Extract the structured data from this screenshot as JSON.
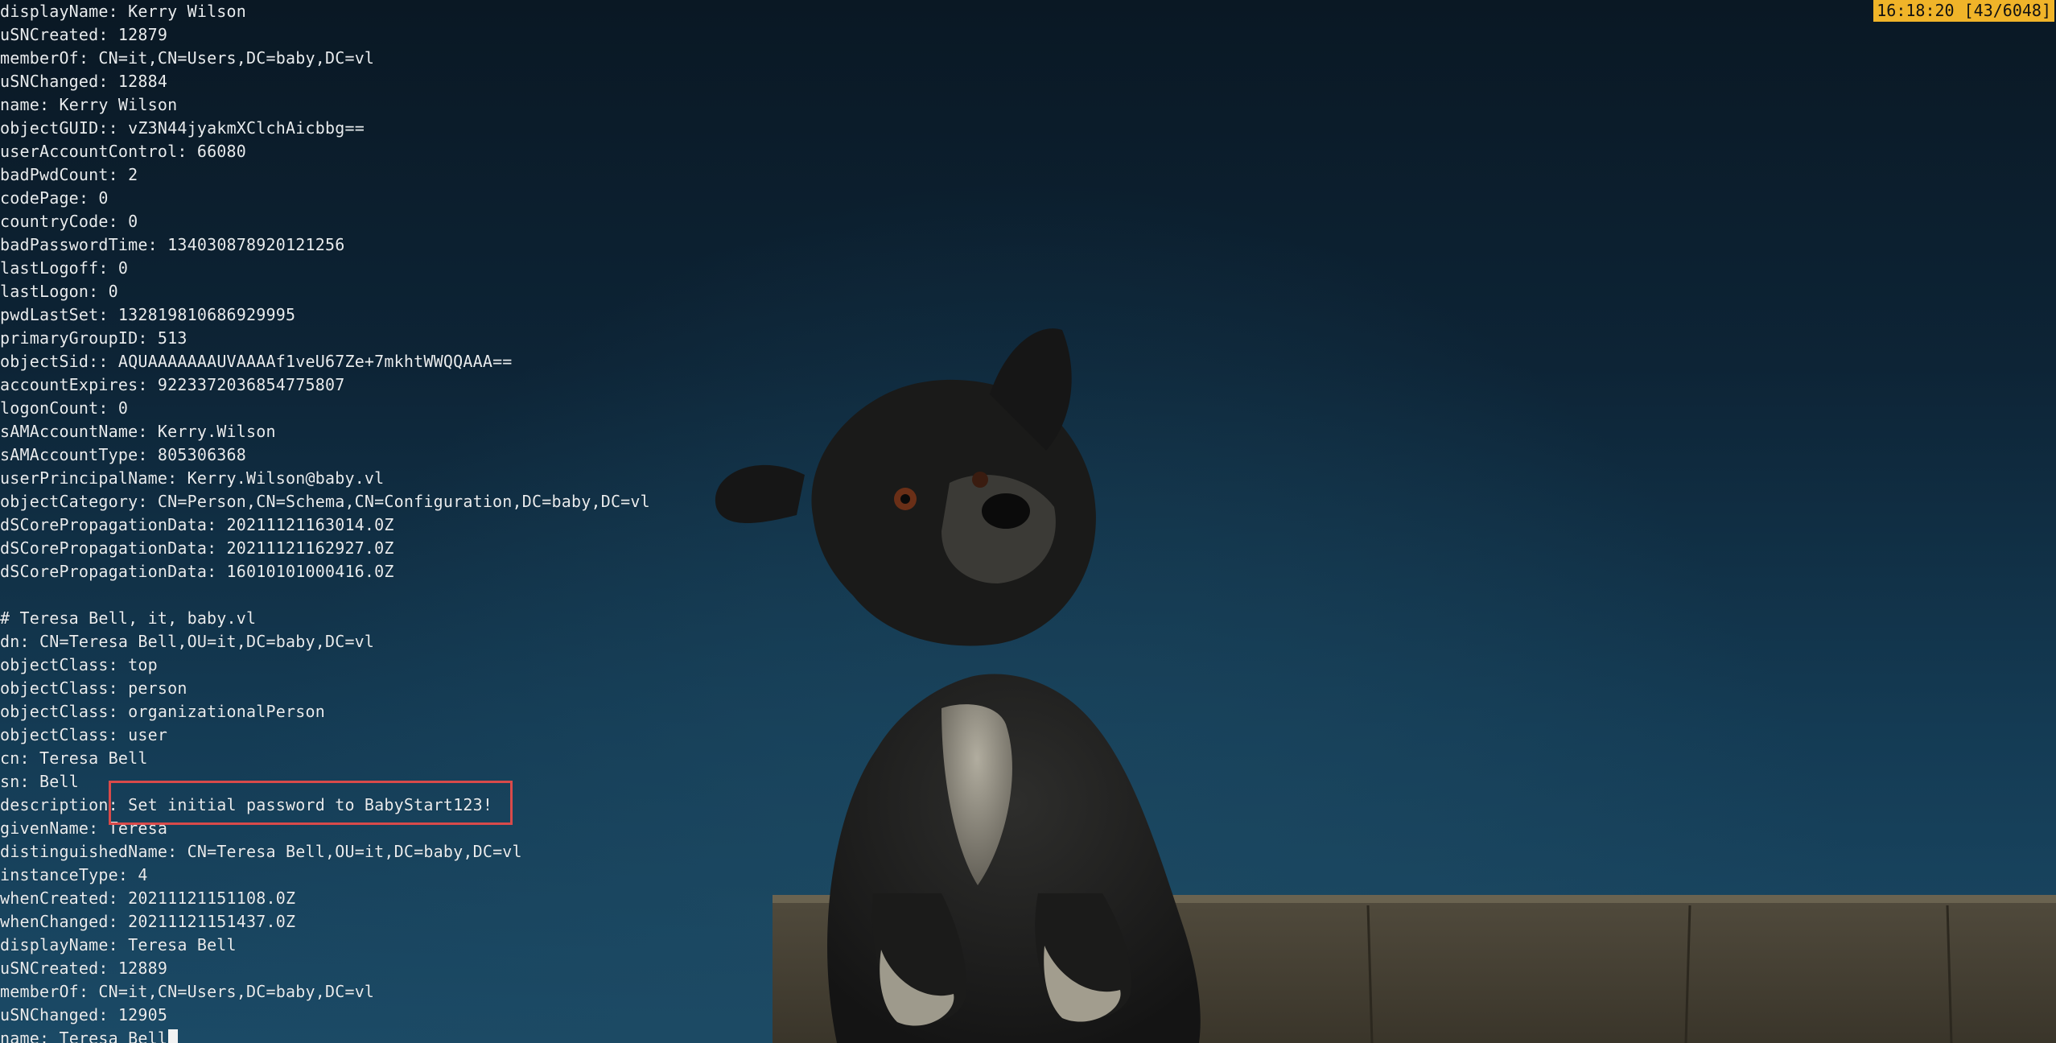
{
  "terminal": {
    "status_time": "16:18:20 [43/6048]",
    "lines": [
      {
        "key": "displayName",
        "sep": ": ",
        "value": "Kerry Wilson"
      },
      {
        "key": "uSNCreated",
        "sep": ": ",
        "value": "12879"
      },
      {
        "key": "memberOf",
        "sep": ": ",
        "value": "CN=it,CN=Users,DC=baby,DC=vl"
      },
      {
        "key": "uSNChanged",
        "sep": ": ",
        "value": "12884"
      },
      {
        "key": "name",
        "sep": ": ",
        "value": "Kerry Wilson"
      },
      {
        "key": "objectGUID",
        "sep": ":: ",
        "value": "vZ3N44jyakmXClchAicbbg=="
      },
      {
        "key": "userAccountControl",
        "sep": ": ",
        "value": "66080"
      },
      {
        "key": "badPwdCount",
        "sep": ": ",
        "value": "2"
      },
      {
        "key": "codePage",
        "sep": ": ",
        "value": "0"
      },
      {
        "key": "countryCode",
        "sep": ": ",
        "value": "0"
      },
      {
        "key": "badPasswordTime",
        "sep": ": ",
        "value": "134030878920121256"
      },
      {
        "key": "lastLogoff",
        "sep": ": ",
        "value": "0"
      },
      {
        "key": "lastLogon",
        "sep": ": ",
        "value": "0"
      },
      {
        "key": "pwdLastSet",
        "sep": ": ",
        "value": "132819810686929995"
      },
      {
        "key": "primaryGroupID",
        "sep": ": ",
        "value": "513"
      },
      {
        "key": "objectSid",
        "sep": ":: ",
        "value": "AQUAAAAAAAUVAAAAf1veU67Ze+7mkhtWWQQAAA=="
      },
      {
        "key": "accountExpires",
        "sep": ": ",
        "value": "9223372036854775807"
      },
      {
        "key": "logonCount",
        "sep": ": ",
        "value": "0"
      },
      {
        "key": "sAMAccountName",
        "sep": ": ",
        "value": "Kerry.Wilson"
      },
      {
        "key": "sAMAccountType",
        "sep": ": ",
        "value": "805306368"
      },
      {
        "key": "userPrincipalName",
        "sep": ": ",
        "value": "Kerry.Wilson@baby.vl"
      },
      {
        "key": "objectCategory",
        "sep": ": ",
        "value": "CN=Person,CN=Schema,CN=Configuration,DC=baby,DC=vl"
      },
      {
        "key": "dSCorePropagationData",
        "sep": ": ",
        "value": "20211121163014.0Z"
      },
      {
        "key": "dSCorePropagationData",
        "sep": ": ",
        "value": "20211121162927.0Z"
      },
      {
        "key": "dSCorePropagationData",
        "sep": ": ",
        "value": "16010101000416.0Z"
      },
      {
        "key": "",
        "sep": "",
        "value": ""
      },
      {
        "key": "",
        "sep": "",
        "value": "# Teresa Bell, it, baby.vl"
      },
      {
        "key": "dn",
        "sep": ": ",
        "value": "CN=Teresa Bell,OU=it,DC=baby,DC=vl"
      },
      {
        "key": "objectClass",
        "sep": ": ",
        "value": "top"
      },
      {
        "key": "objectClass",
        "sep": ": ",
        "value": "person"
      },
      {
        "key": "objectClass",
        "sep": ": ",
        "value": "organizationalPerson"
      },
      {
        "key": "objectClass",
        "sep": ": ",
        "value": "user"
      },
      {
        "key": "cn",
        "sep": ": ",
        "value": "Teresa Bell"
      },
      {
        "key": "sn",
        "sep": ": ",
        "value": "Bell"
      },
      {
        "key": "description",
        "sep": ": ",
        "value": "Set initial password to BabyStart123!"
      },
      {
        "key": "givenName",
        "sep": ": ",
        "value": "Teresa"
      },
      {
        "key": "distinguishedName",
        "sep": ": ",
        "value": "CN=Teresa Bell,OU=it,DC=baby,DC=vl"
      },
      {
        "key": "instanceType",
        "sep": ": ",
        "value": "4"
      },
      {
        "key": "whenCreated",
        "sep": ": ",
        "value": "20211121151108.0Z"
      },
      {
        "key": "whenChanged",
        "sep": ": ",
        "value": "20211121151437.0Z"
      },
      {
        "key": "displayName",
        "sep": ": ",
        "value": "Teresa Bell"
      },
      {
        "key": "uSNCreated",
        "sep": ": ",
        "value": "12889"
      },
      {
        "key": "memberOf",
        "sep": ": ",
        "value": "CN=it,CN=Users,DC=baby,DC=vl"
      },
      {
        "key": "uSNChanged",
        "sep": ": ",
        "value": "12905"
      },
      {
        "key": "name",
        "sep": ": ",
        "value": "Teresa Bell"
      }
    ]
  },
  "colors": {
    "status_bg": "#f0b429",
    "highlight_border": "#d94a4a",
    "text": "#e8ecef"
  },
  "wallpaper": {
    "subject": "dog-illustration"
  }
}
